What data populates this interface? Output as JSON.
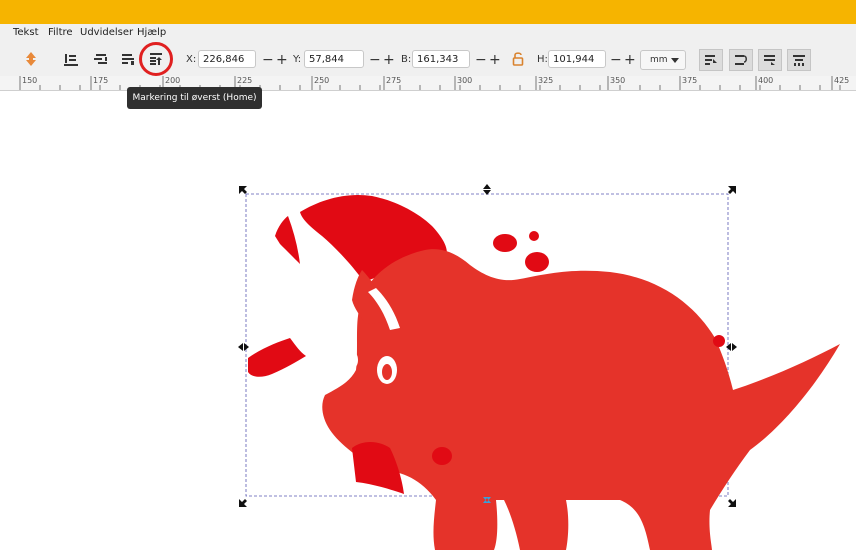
{
  "menu": {
    "items": [
      "Tekst",
      "Filtre",
      "Udvidelser",
      "Hjælp"
    ]
  },
  "toolbar": {
    "fields": [
      {
        "label": "X:",
        "value": "226,846"
      },
      {
        "label": "Y:",
        "value": "57,844"
      },
      {
        "label": "B:",
        "value": "161,343"
      },
      {
        "label": "H:",
        "value": "101,944"
      }
    ],
    "unit": "mm",
    "icons": [
      "raise-icon",
      "align-bottom-icon",
      "align-left-icon",
      "align-right-icon",
      "raise-to-top-icon",
      "lock-icon"
    ]
  },
  "ruler": {
    "labels": [
      "150",
      "175",
      "200",
      "225",
      "250",
      "275",
      "300",
      "325",
      "350",
      "375",
      "400",
      "425"
    ]
  },
  "tooltip": {
    "text": "Markering til øverst (Home)"
  },
  "colors": {
    "brand": "#f6b400",
    "dino": "#e5332a",
    "dino_dark": "#e10a14",
    "highlight": "#e02020"
  }
}
